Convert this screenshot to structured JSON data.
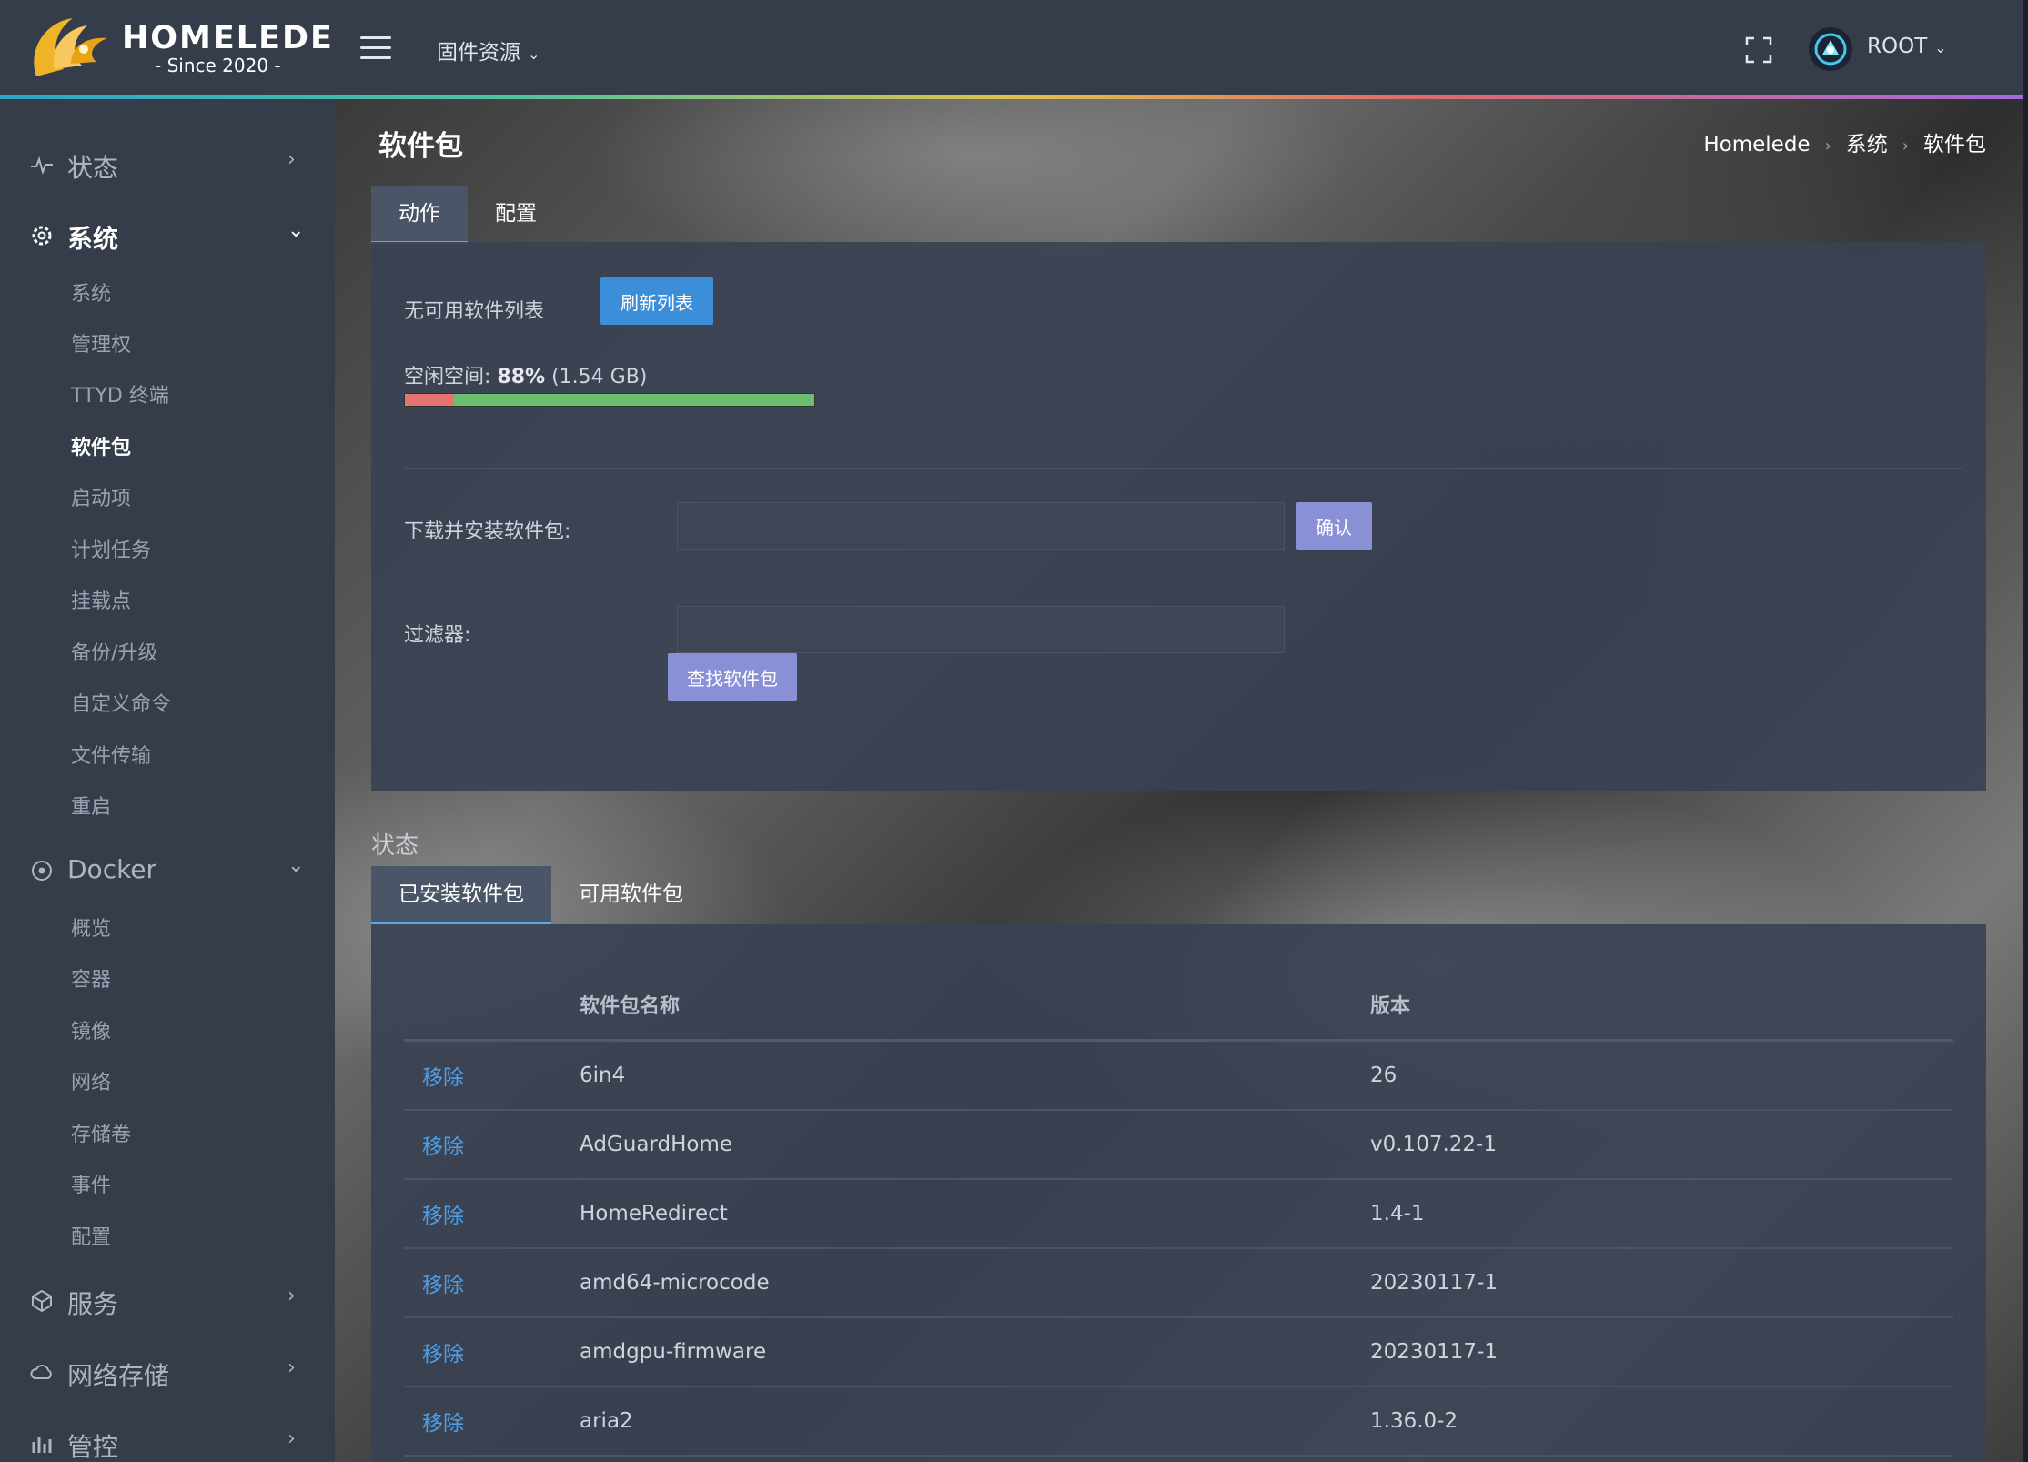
{
  "header": {
    "logo_text": "HOMELEDE",
    "logo_sub": "- Since 2020 -",
    "firmware_menu": "固件资源",
    "user": "ROOT"
  },
  "sidebar": {
    "status": "状态",
    "system": {
      "label": "系统",
      "items": [
        "系统",
        "管理权",
        "TTYD 终端",
        "软件包",
        "启动项",
        "计划任务",
        "挂载点",
        "备份/升级",
        "自定义命令",
        "文件传输",
        "重启"
      ],
      "active_index": 3
    },
    "docker": {
      "label": "Docker",
      "items": [
        "概览",
        "容器",
        "镜像",
        "网络",
        "存储卷",
        "事件",
        "配置"
      ]
    },
    "services": "服务",
    "nas": "网络存储",
    "partial": "管控"
  },
  "page": {
    "title": "软件包",
    "breadcrumb": [
      "Homelede",
      "系统",
      "软件包"
    ]
  },
  "tabs_top": [
    "动作",
    "配置"
  ],
  "actions": {
    "no_list": "无可用软件列表",
    "refresh_button": "刷新列表",
    "free_space_label": "空闲空间:",
    "free_space_value": "88%",
    "free_space_size": "(1.54 GB)",
    "free_space_fraction": 0.88,
    "install_label": "下载并安装软件包:",
    "install_value": "",
    "confirm_button": "确认",
    "filter_label": "过滤器:",
    "filter_value": "",
    "find_button": "查找软件包"
  },
  "status": {
    "heading": "状态",
    "tabs": [
      "已安装软件包",
      "可用软件包"
    ],
    "table": {
      "col_name": "软件包名称",
      "col_version": "版本",
      "remove_label": "移除",
      "rows": [
        {
          "name": "6in4",
          "version": "26"
        },
        {
          "name": "AdGuardHome",
          "version": "v0.107.22-1"
        },
        {
          "name": "HomeRedirect",
          "version": "1.4-1"
        },
        {
          "name": "amd64-microcode",
          "version": "20230117-1"
        },
        {
          "name": "amdgpu-firmware",
          "version": "20230117-1"
        },
        {
          "name": "aria2",
          "version": "1.36.0-2"
        }
      ]
    }
  },
  "colors": {
    "accent_blue": "#3b8fd9",
    "button_purple": "#8a90d6",
    "link_blue": "#4d9ee8",
    "free_green": "#6fbf73",
    "used_red": "#e57373"
  }
}
